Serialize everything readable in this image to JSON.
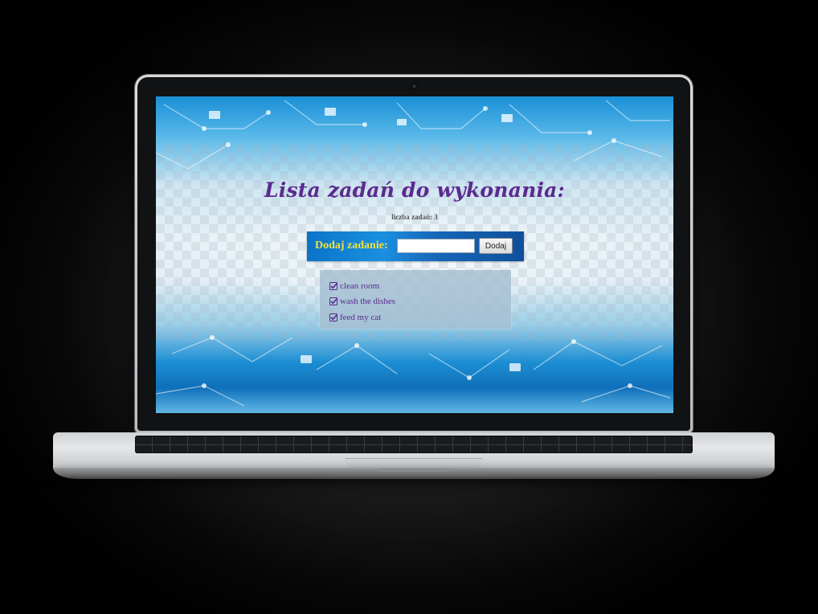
{
  "app": {
    "title": "Lista zadań do wykonania:",
    "task_count_label": "liczba zadań: 3"
  },
  "add_form": {
    "label": "Dodaj zadanie:",
    "input_value": "",
    "button_label": "Dodaj"
  },
  "tasks": [
    {
      "label": "clean room",
      "icon": "checkbox-checked-icon"
    },
    {
      "label": "wash the dishes",
      "icon": "checkbox-checked-icon"
    },
    {
      "label": "feed my cat",
      "icon": "checkbox-checked-icon"
    }
  ],
  "colors": {
    "title": "#5b2a8f",
    "add_label": "#f0e23a",
    "add_bar": "#1b8fe0",
    "task_panel": "#a6c0d2"
  }
}
